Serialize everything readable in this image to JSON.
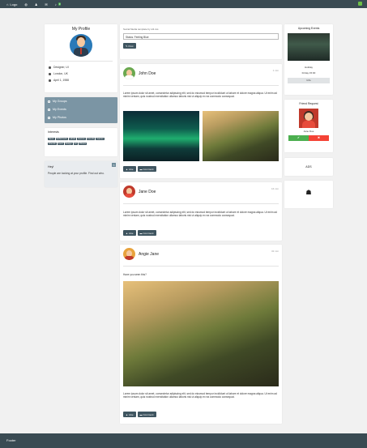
{
  "topbar": {
    "logo_label": "Logo",
    "nav_icons": [
      "globe-icon",
      "user-icon",
      "envelope-icon",
      "bell-icon"
    ],
    "bell_badge": "3"
  },
  "profile": {
    "title": "My Profile",
    "role": "Designer, UI",
    "location": "London, UK",
    "birthday": "April 1, 1988"
  },
  "left_menu": {
    "items": [
      {
        "label": "My Groups"
      },
      {
        "label": "My Events"
      },
      {
        "label": "My Photos"
      }
    ]
  },
  "interests": {
    "title": "Interests",
    "tags": [
      "News",
      "W3Schools",
      "Labels",
      "Games",
      "Friends",
      "Games",
      "Friends",
      "Food",
      "Design",
      "Art",
      "Photos"
    ]
  },
  "alert": {
    "title": "Hey!",
    "text": "People are looking at your profile. Find out who."
  },
  "status_box": {
    "template_label": "Social Media template by w3.css",
    "input_value": "Status: Feeling Blue",
    "post_button": "Post"
  },
  "posts": [
    {
      "author": "John Doe",
      "time": "1 min",
      "text": "Lorem ipsum dolor sit amet, consectetur adipiscing elit, sed do eiusmod tempor incididunt ut labore et dolore magna aliqua. Ut enim ad minim veniam, quis nostrud exercitation ullamco laboris nisi ut aliquip ex ea commodo consequat.",
      "like_label": "Like",
      "comment_label": "Comment"
    },
    {
      "author": "Jane Doe",
      "time": "16 min",
      "text": "Lorem ipsum dolor sit amet, consectetur adipiscing elit, sed do eiusmod tempor incididunt ut labore et dolore magna aliqua. Ut enim ad minim veniam, quis nostrud exercitation ullamco laboris nisi ut aliquip ex ea commodo consequat.",
      "like_label": "Like",
      "comment_label": "Comment"
    },
    {
      "author": "Angie Jane",
      "time": "32 min",
      "intro": "Have you seen this?",
      "text": "Lorem ipsum dolor sit amet, consectetur adipiscing elit, sed do eiusmod tempor incididunt ut labore et dolore magna aliqua. Ut enim ad minim veniam, quis nostrud exercitation ullamco laboris nisi ut aliquip ex ea commodo consequat.",
      "like_label": "Like",
      "comment_label": "Comment"
    }
  ],
  "events": {
    "title": "Upcoming Events",
    "name": "Holiday",
    "when": "Friday 15:00",
    "info_button": "Info"
  },
  "friend_request": {
    "title": "Friend Request",
    "name": "Jane Doe"
  },
  "ads": {
    "label": "ADS"
  },
  "footer": {
    "label": "Footer"
  },
  "colors": {
    "topbar": "#3a4b53",
    "accent_blue": "#7b95a4",
    "accept_green": "#4caf50",
    "decline_red": "#f44336"
  }
}
